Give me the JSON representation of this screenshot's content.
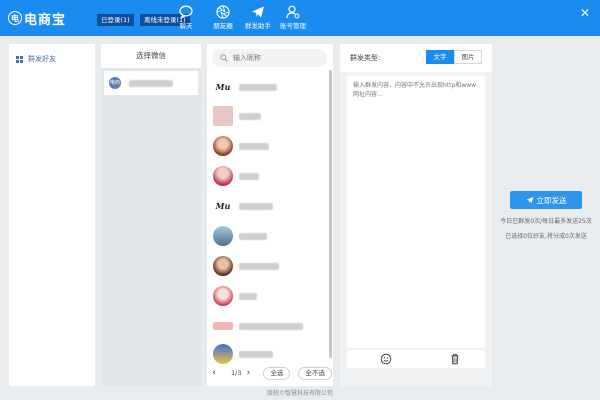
{
  "topbar": {
    "logo_mark": "电",
    "logo_text": "电商宝",
    "badge_logged_in": "已登录(1)",
    "badge_offline": "离线未登录(1)",
    "nav": [
      {
        "label": "聊天",
        "icon": "chat-bubble-icon"
      },
      {
        "label": "朋友圈",
        "icon": "aperture-icon"
      },
      {
        "label": "群发助手",
        "icon": "paper-plane-icon"
      },
      {
        "label": "账号管理",
        "icon": "user-settings-icon"
      }
    ],
    "close": "✕",
    "color": "#1a8cf0"
  },
  "sidebar": {
    "items": [
      {
        "label": "群发好友",
        "icon": "grid-icon"
      }
    ]
  },
  "wechat_panel": {
    "title": "选择微信",
    "account_avatar_text": "电商"
  },
  "friends_panel": {
    "search_placeholder": "输入昵称",
    "friend_count": 10,
    "pager": {
      "prev": "‹",
      "page": "1/3",
      "next": "›",
      "select_all": "全选",
      "select_none": "全不选"
    }
  },
  "compose": {
    "type_label": "群发类型:",
    "type_text": "文字",
    "type_image": "图片",
    "placeholder": "输入群发内容，内容中不允许出现http和www网址内容...",
    "emoji_icon": "smiley-icon",
    "delete_icon": "trash-icon"
  },
  "send": {
    "button_label": "立即发送",
    "stats_line1": "今日已群发0次/每日最多发送25次",
    "stats_line2": "已选择0位好友,将分成0次发送"
  },
  "footer": {
    "copyright": "版权©智慧科技有限公司"
  }
}
